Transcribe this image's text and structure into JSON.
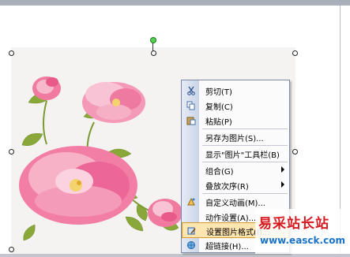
{
  "context_menu": {
    "items": [
      {
        "label": "剪切(T)",
        "icon": "scissors-icon"
      },
      {
        "label": "复制(C)",
        "icon": "copy-icon"
      },
      {
        "label": "粘贴(P)",
        "icon": "paste-icon"
      },
      {
        "label": "另存为图片(S)...",
        "icon": ""
      },
      {
        "label": "显示\"图片\"工具栏(B)",
        "icon": ""
      },
      {
        "label": "组合(G)",
        "icon": "",
        "submenu": true
      },
      {
        "label": "叠放次序(R)",
        "icon": "",
        "submenu": true
      },
      {
        "label": "自定义动画(M)...",
        "icon": "custom-animation-icon"
      },
      {
        "label": "动作设置(A)...",
        "icon": ""
      },
      {
        "label": "设置图片格式(I)...",
        "icon": "format-picture-icon",
        "highlighted": true
      },
      {
        "label": "超链接(H)...",
        "icon": "hyperlink-icon"
      }
    ]
  },
  "watermark": {
    "title": "易采站长站",
    "url": "www.easck.com"
  },
  "colors": {
    "menu_highlight": "#ffe5b0",
    "watermark_red": "#d71920",
    "watermark_blue": "#1a73c8"
  }
}
